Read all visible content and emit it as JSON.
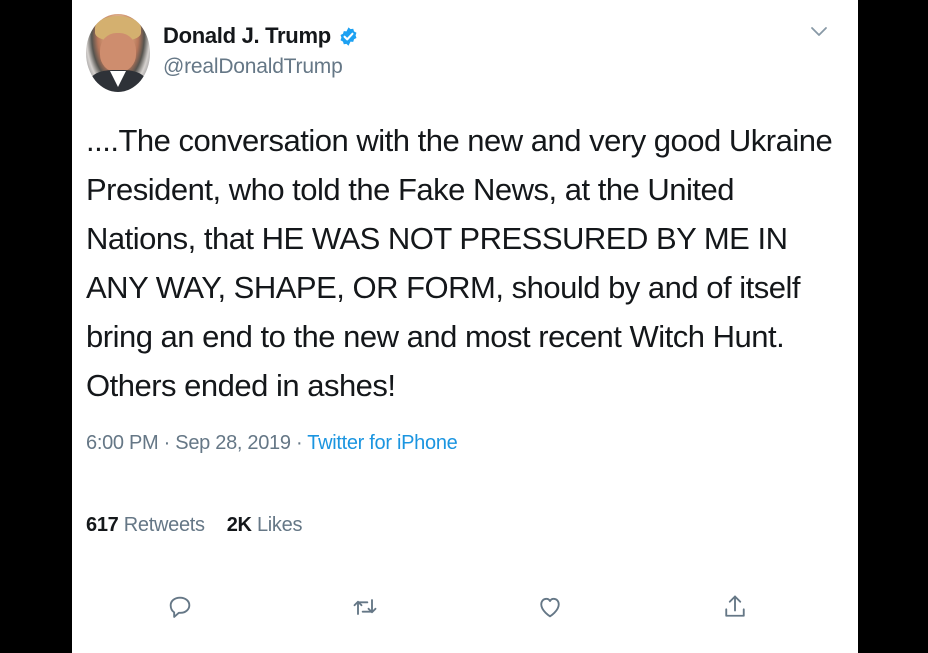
{
  "tweet": {
    "author": {
      "display_name": "Donald J. Trump",
      "handle": "@realDonaldTrump",
      "verified": true
    },
    "text": "....The conversation with the new and very good Ukraine President, who told the Fake News, at the United Nations, that HE WAS NOT PRESSURED BY ME IN ANY WAY, SHAPE, OR FORM, should by and of itself bring an end to the new and most recent Witch Hunt. Others ended in ashes!",
    "meta": {
      "time": "6:00 PM",
      "date": "Sep 28, 2019",
      "separator": "·",
      "source": "Twitter for iPhone"
    },
    "stats": {
      "retweets_count": "617",
      "retweets_label": "Retweets",
      "likes_count": "2K",
      "likes_label": "Likes"
    }
  },
  "icons": {
    "verified": "verified-badge-icon",
    "menu": "chevron-down-icon",
    "reply": "reply-icon",
    "retweet": "retweet-icon",
    "like": "heart-icon",
    "share": "share-icon"
  },
  "colors": {
    "text_primary": "#14171a",
    "text_secondary": "#657786",
    "link": "#1b95e0",
    "verified": "#1da1f2",
    "background": "#ffffff",
    "letterbox": "#000000"
  }
}
